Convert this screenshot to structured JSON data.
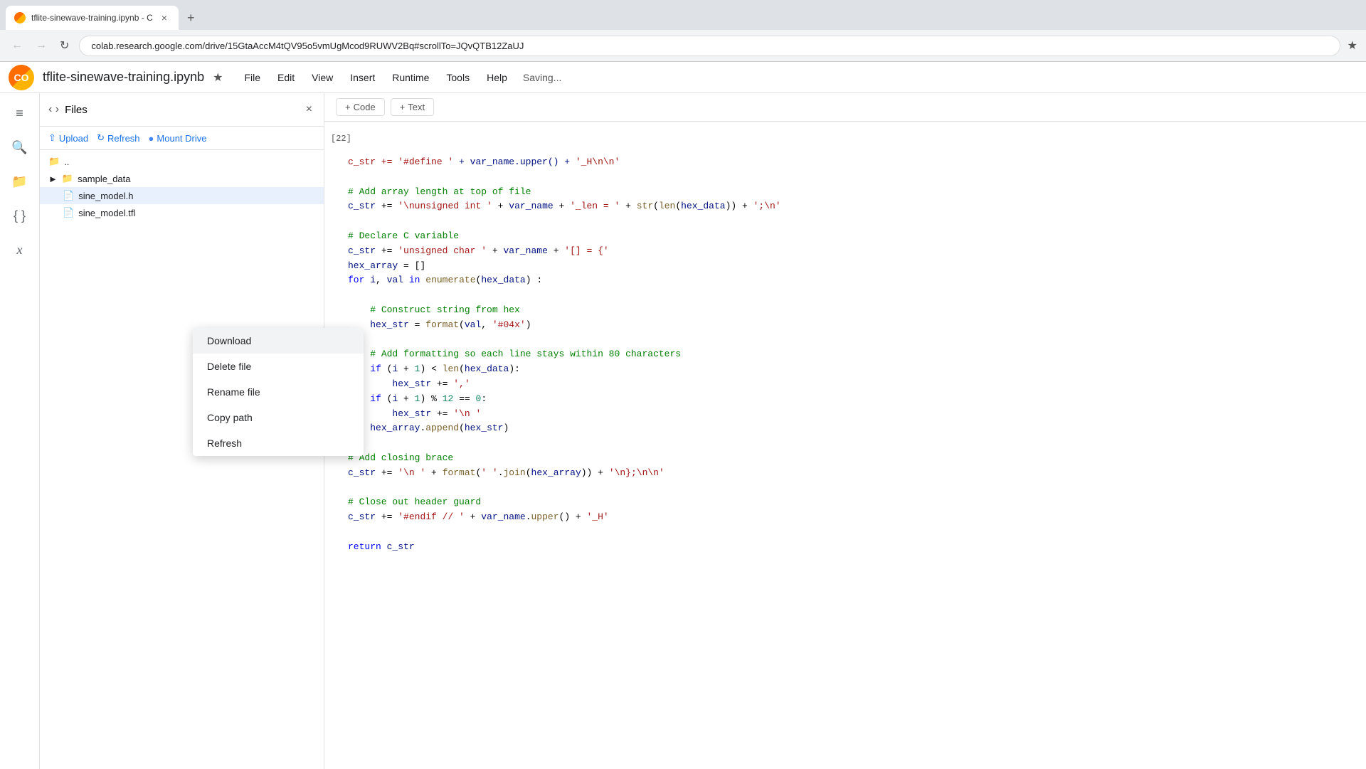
{
  "browser": {
    "tab_favicon": "CO",
    "tab_title": "tflite-sinewave-training.ipynb - C",
    "close_icon": "×",
    "new_tab_icon": "+",
    "back_icon": "←",
    "forward_icon": "→",
    "refresh_icon": "↻",
    "url": "colab.research.google.com/drive/15GtaAccM4tQV95o5vmUgMcod9RUWV2Bq#scrollTo=JQvQTB12ZaUJ",
    "star_icon": "☆"
  },
  "app": {
    "logo_text": "CO",
    "doc_title": "tflite-sinewave-training.ipynb",
    "star_icon": "☆",
    "saving_text": "Saving...",
    "menu_items": [
      "File",
      "Edit",
      "View",
      "Insert",
      "Runtime",
      "Tools",
      "Help"
    ]
  },
  "toolbar": {
    "add_code_label": "+ Code",
    "add_text_label": "+ Text"
  },
  "files_panel": {
    "title": "Files",
    "close_icon": "×",
    "upload_label": "Upload",
    "refresh_label": "Refresh",
    "mount_drive_label": "Mount Drive",
    "tree_items": [
      {
        "type": "nav",
        "label": "..",
        "icon": "📁"
      },
      {
        "type": "folder",
        "label": "sample_data",
        "icon": "📁"
      },
      {
        "type": "file",
        "label": "sine_model.h",
        "icon": "📄",
        "selected": true
      },
      {
        "type": "file",
        "label": "sine_model.tfl",
        "icon": "📄"
      }
    ]
  },
  "context_menu": {
    "items": [
      {
        "label": "Download",
        "active": true
      },
      {
        "label": "Delete file",
        "active": false
      },
      {
        "label": "Rename file",
        "active": false
      },
      {
        "label": "Copy path",
        "active": false
      },
      {
        "label": "Refresh",
        "active": false
      }
    ]
  },
  "cell": {
    "number": "[22]",
    "code_lines": [
      "c_str += '#define ' + var_name.upper() + '_H\\n\\n'",
      "",
      "# Add array length at top of file",
      "c_str += '\\nunsigned int ' + var_name + '_len = ' + str(len(hex_data)) + ';\\n'",
      "",
      "# Declare C variable",
      "c_str += 'unsigned char ' + var_name + '[] = {'",
      "hex_array = []",
      "for i, val in enumerate(hex_data):",
      "",
      "    # Construct string from hex",
      "    hex_str = format(val, '#04x')",
      "",
      "    # Add formatting so each line stays within 80 characters",
      "    if (i + 1) < len(hex_data):",
      "        hex_str += ','",
      "    if (i + 1) % 12 == 0:",
      "        hex_str += '\\n '",
      "    hex_array.append(hex_str)",
      "",
      "# Add closing brace",
      "c_str += '\\n ' + format(' '.join(hex_array)) + '\\n};\\n\\n'",
      "",
      "# Close out header guard",
      "c_str += '#endif // ' + var_name.upper() + '_H'",
      "",
      "return c_str"
    ]
  },
  "left_nav": {
    "toc_icon": "≡",
    "search_icon": "🔍",
    "files_icon": "📁",
    "code_snippets_icon": "{ }",
    "variables_icon": "x",
    "nav_arrows": "‹ ›"
  }
}
